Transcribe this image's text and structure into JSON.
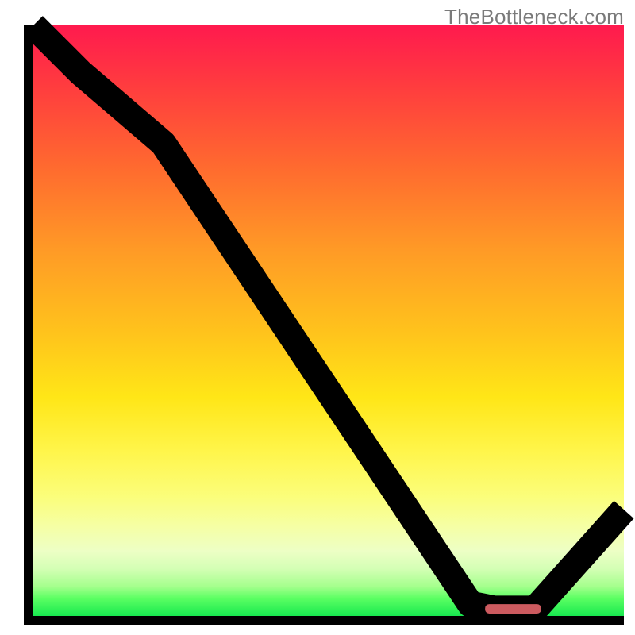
{
  "watermark": "TheBottleneck.com",
  "chart_data": {
    "type": "line",
    "title": "",
    "xlabel": "",
    "ylabel": "",
    "xlim": [
      0,
      100
    ],
    "ylim": [
      0,
      100
    ],
    "grid": false,
    "series": [
      {
        "name": "curve",
        "x": [
          0,
          8,
          22,
          74,
          78,
          85,
          100
        ],
        "y": [
          100,
          92,
          80,
          2.0,
          1.2,
          1.2,
          18
        ]
      }
    ],
    "marker": {
      "x_start": 76.5,
      "x_end": 86,
      "y": 1.2,
      "color": "#cc5a5f"
    },
    "gradient_stops": [
      {
        "pos": 0,
        "color": "#ff1a4e"
      },
      {
        "pos": 10,
        "color": "#ff3b3f"
      },
      {
        "pos": 24,
        "color": "#ff6a2f"
      },
      {
        "pos": 38,
        "color": "#ff9a26"
      },
      {
        "pos": 52,
        "color": "#ffc31c"
      },
      {
        "pos": 63,
        "color": "#ffe617"
      },
      {
        "pos": 72,
        "color": "#fff54a"
      },
      {
        "pos": 80,
        "color": "#fbfe7c"
      },
      {
        "pos": 85,
        "color": "#f5ffa6"
      },
      {
        "pos": 89,
        "color": "#edffc5"
      },
      {
        "pos": 92,
        "color": "#d4ffb5"
      },
      {
        "pos": 95,
        "color": "#a5ff8d"
      },
      {
        "pos": 97,
        "color": "#5cff63"
      },
      {
        "pos": 100,
        "color": "#17e84f"
      }
    ]
  }
}
